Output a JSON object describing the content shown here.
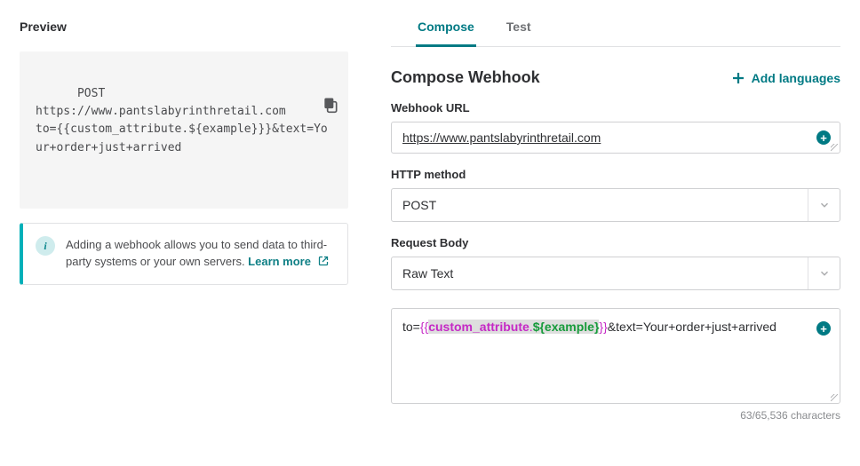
{
  "left": {
    "title": "Preview",
    "preview_text": "POST\nhttps://www.pantslabyrinthretail.com\nto={{custom_attribute.${example}}}&text=Your+order+just+arrived",
    "tip_text": "Adding a webhook allows you to send data to third-party systems or your own servers.  ",
    "tip_link_label": "Learn more"
  },
  "right": {
    "tabs": {
      "compose": "Compose",
      "test": "Test"
    },
    "title": "Compose Webhook",
    "add_languages_label": "Add languages",
    "url_label": "Webhook URL",
    "url_value": "https://www.pantslabyrinthretail.com",
    "http_label": "HTTP method",
    "http_value": "POST",
    "body_label": "Request Body",
    "body_type_value": "Raw Text",
    "body_tokens": {
      "prefix": "to=",
      "delim_open": "{{",
      "attr": "custom_attribute",
      "dot": ".",
      "var": "${example}",
      "delim_close": "}}",
      "suffix": "&text=Your+order+just+arrived"
    },
    "char_count": "63/65,536 characters"
  }
}
